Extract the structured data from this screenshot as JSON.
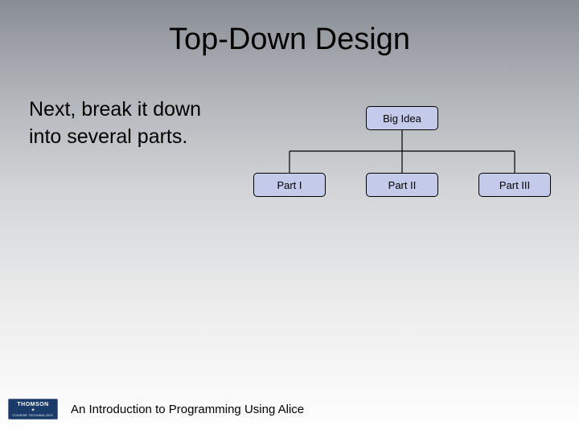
{
  "title": "Top-Down Design",
  "body_line1": "Next, break it down",
  "body_line2": "into several parts.",
  "chart_data": {
    "type": "tree",
    "root": "Big Idea",
    "children": [
      "Part I",
      "Part II",
      "Part III"
    ]
  },
  "logo": {
    "line1": "THOMSON",
    "line2": "COURSE TECHNOLOGY"
  },
  "footer": "An Introduction to Programming Using Alice"
}
